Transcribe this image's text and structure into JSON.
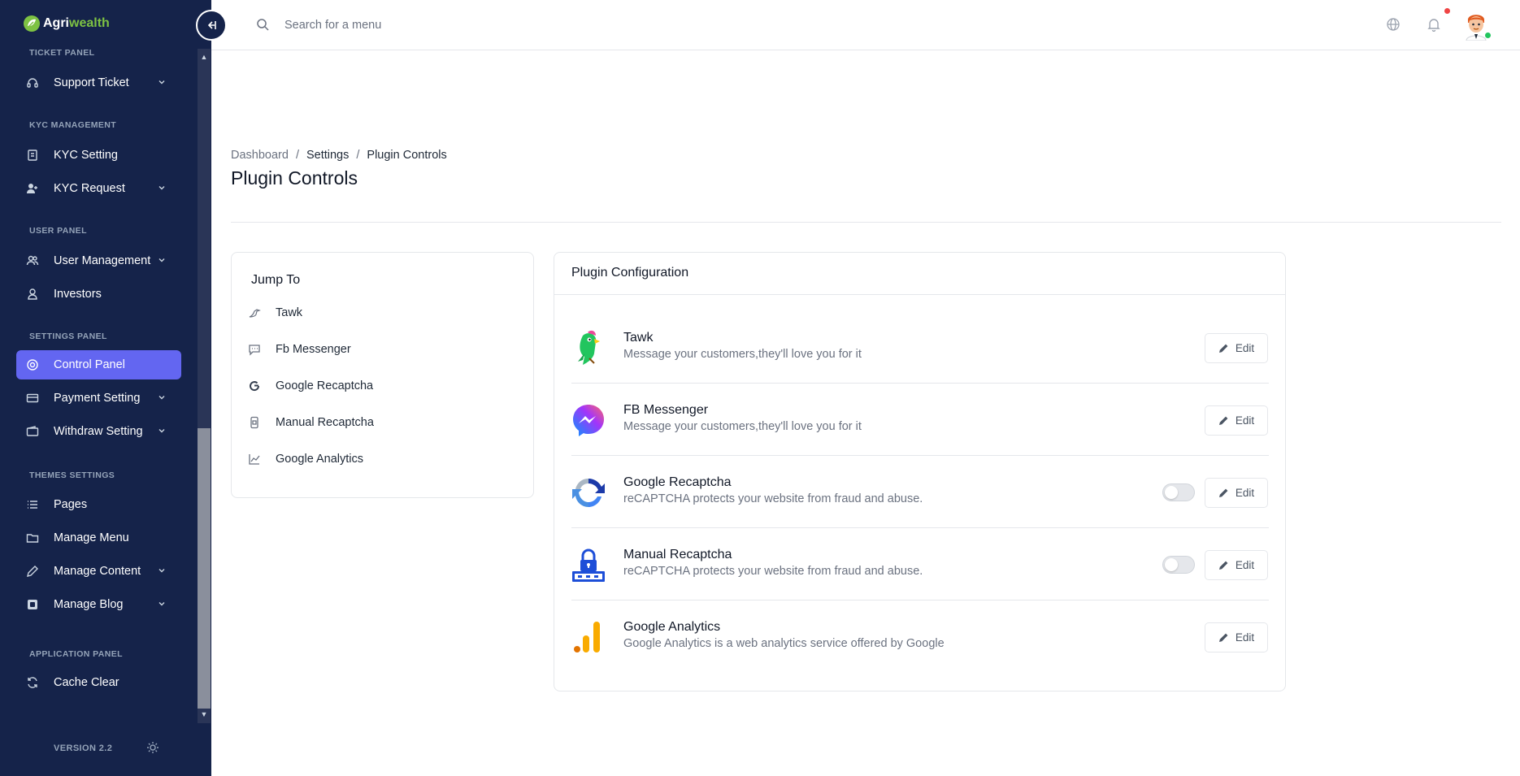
{
  "brand": {
    "name_part1": "Agri",
    "name_part2": "wealth"
  },
  "sidebar": {
    "sections": [
      {
        "title": "TICKET PANEL"
      },
      {
        "title": "KYC MANAGEMENT"
      },
      {
        "title": "USER PANEL"
      },
      {
        "title": "SETTINGS PANEL"
      },
      {
        "title": "THEMES SETTINGS"
      },
      {
        "title": "APPLICATION PANEL"
      }
    ],
    "items": [
      {
        "label": "Support Ticket",
        "icon": "headset-icon",
        "has_submenu": true
      },
      {
        "label": "KYC Setting",
        "icon": "document-icon",
        "has_submenu": false
      },
      {
        "label": "KYC Request",
        "icon": "user-add-icon",
        "has_submenu": true
      },
      {
        "label": "User Management",
        "icon": "users-icon",
        "has_submenu": true
      },
      {
        "label": "Investors",
        "icon": "user-icon",
        "has_submenu": false
      },
      {
        "label": "Control Panel",
        "icon": "gear-icon",
        "has_submenu": false,
        "active": true
      },
      {
        "label": "Payment Setting",
        "icon": "card-icon",
        "has_submenu": true
      },
      {
        "label": "Withdraw Setting",
        "icon": "wallet-icon",
        "has_submenu": true
      },
      {
        "label": "Pages",
        "icon": "list-icon",
        "has_submenu": false
      },
      {
        "label": "Manage Menu",
        "icon": "folder-icon",
        "has_submenu": false
      },
      {
        "label": "Manage Content",
        "icon": "pencil-icon",
        "has_submenu": true
      },
      {
        "label": "Manage Blog",
        "icon": "blog-icon",
        "has_submenu": true
      },
      {
        "label": "Cache Clear",
        "icon": "refresh-icon",
        "has_submenu": false
      }
    ],
    "version": "VERSION 2.2"
  },
  "topbar": {
    "search_placeholder": "Search for a menu"
  },
  "breadcrumb": {
    "items": [
      "Dashboard",
      "Settings",
      "Plugin Controls"
    ]
  },
  "page_title": "Plugin Controls",
  "jump_to": {
    "title": "Jump To",
    "items": [
      {
        "label": "Tawk",
        "icon": "bird-icon"
      },
      {
        "label": "Fb Messenger",
        "icon": "message-icon"
      },
      {
        "label": "Google Recaptcha",
        "icon": "google-icon"
      },
      {
        "label": "Manual Recaptcha",
        "icon": "phone-icon"
      },
      {
        "label": "Google Analytics",
        "icon": "chart-icon"
      }
    ]
  },
  "plugin_config": {
    "title": "Plugin Configuration",
    "edit_label": "Edit",
    "plugins": [
      {
        "name": "Tawk",
        "description": "Message your customers,they'll love you for it",
        "has_toggle": false
      },
      {
        "name": "FB Messenger",
        "description": "Message your customers,they'll love you for it",
        "has_toggle": false
      },
      {
        "name": "Google Recaptcha",
        "description": "reCAPTCHA protects your website from fraud and abuse.",
        "has_toggle": true,
        "enabled": false
      },
      {
        "name": "Manual Recaptcha",
        "description": "reCAPTCHA protects your website from fraud and abuse.",
        "has_toggle": true,
        "enabled": false
      },
      {
        "name": "Google Analytics",
        "description": "Google Analytics is a web analytics service offered by Google",
        "has_toggle": false
      }
    ]
  },
  "colors": {
    "sidebar_bg": "#15234a",
    "accent": "#6366f1",
    "brand_green": "#7dc243"
  }
}
